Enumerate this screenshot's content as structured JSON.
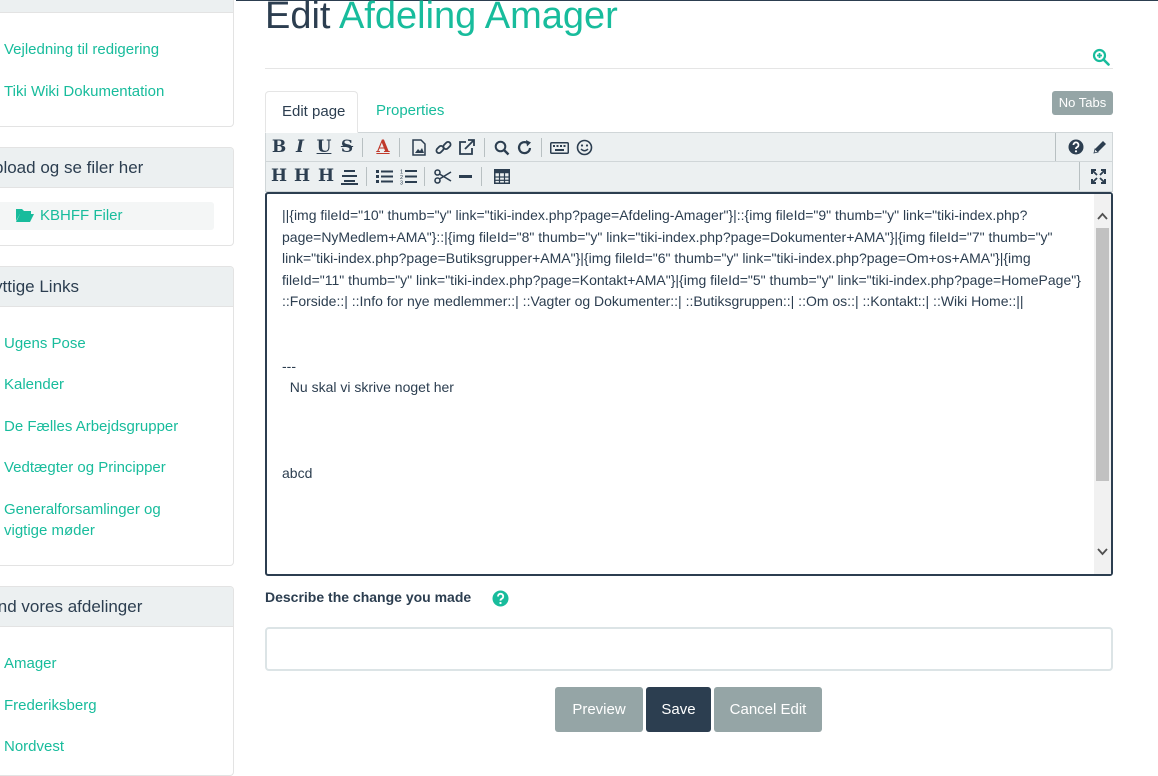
{
  "sidebar": {
    "help_links": [
      "Vejledning til redigering",
      "Tiki Wiki Dokumentation"
    ],
    "upload_panel": {
      "heading": "pload og se filer her",
      "folder_label": "KBHFF Filer"
    },
    "links_panel": {
      "heading": "yttige Links",
      "items": [
        "Ugens Pose",
        "Kalender",
        "De Fælles Arbejdsgrupper",
        "Vedtægter og Principper",
        "Generalforsamlinger og",
        "vigtige møder"
      ]
    },
    "branches_panel": {
      "heading": "ind vores afdelinger",
      "items": [
        "Amager",
        "Frederiksberg",
        "Nordvest"
      ]
    }
  },
  "header": {
    "title_prefix": "Edit",
    "page_name": "Afdeling Amager"
  },
  "tabs": {
    "edit": "Edit page",
    "properties": "Properties",
    "no_tabs": "No Tabs"
  },
  "toolbar": {
    "row1": [
      "B",
      "I",
      "U",
      "S",
      "A"
    ],
    "row2": [
      "H",
      "H",
      "H"
    ]
  },
  "editor": {
    "content": "||{img fileId=\"10\" thumb=\"y\" link=\"tiki-index.php?page=Afdeling-Amager\"}|::{img fileId=\"9\" thumb=\"y\" link=\"tiki-index.php?page=NyMedlem+AMA\"}::|{img fileId=\"8\" thumb=\"y\" link=\"tiki-index.php?page=Dokumenter+AMA\"}|{img fileId=\"7\" thumb=\"y\" link=\"tiki-index.php?page=Butiksgrupper+AMA\"}|{img fileId=\"6\" thumb=\"y\" link=\"tiki-index.php?page=Om+os+AMA\"}|{img fileId=\"11\" thumb=\"y\" link=\"tiki-index.php?page=Kontakt+AMA\"}|{img fileId=\"5\" thumb=\"y\" link=\"tiki-index.php?page=HomePage\"}\n::Forside::| ::Info for nye medlemmer::| ::Vagter og Dokumenter::| ::Butiksgruppen::| ::Om os::| ::Kontakt::| ::Wiki Home::||\n\n\n---\n  Nu skal vi skrive noget her\n\n\n\nabcd"
  },
  "describe": {
    "label": "Describe the change you made",
    "value": ""
  },
  "buttons": {
    "preview": "Preview",
    "save": "Save",
    "cancel": "Cancel Edit"
  },
  "colors": {
    "accent": "#18bc9c",
    "primary": "#2c3e50",
    "muted": "#95a5a6",
    "panel_bg": "#ecf0f1"
  }
}
